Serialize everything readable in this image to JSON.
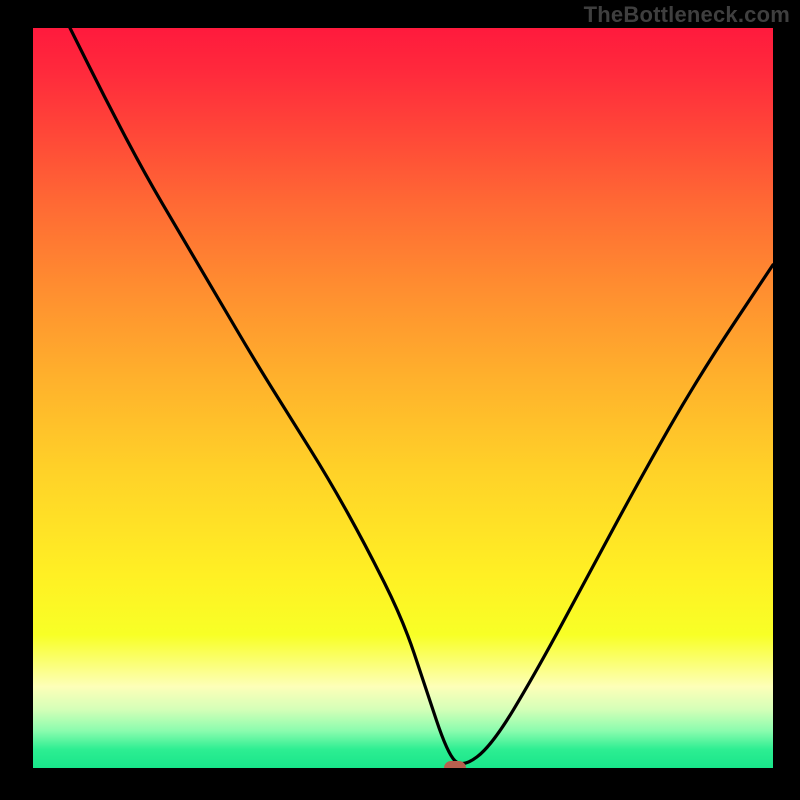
{
  "watermark": {
    "text": "TheBottleneck.com"
  },
  "colors": {
    "frame": "#000000",
    "curve": "#000000",
    "marker": "#b7604e",
    "watermark": "#3f3f3f"
  },
  "chart_data": {
    "type": "line",
    "title": "",
    "xlabel": "",
    "ylabel": "",
    "xlim": [
      0,
      100
    ],
    "ylim": [
      0,
      100
    ],
    "grid": false,
    "background_gradient": {
      "direction": "vertical",
      "stops": [
        {
          "pos": 0.0,
          "color": "#ff1a3d"
        },
        {
          "pos": 0.25,
          "color": "#ff6e34"
        },
        {
          "pos": 0.55,
          "color": "#ffd228"
        },
        {
          "pos": 0.8,
          "color": "#f6ff26"
        },
        {
          "pos": 0.9,
          "color": "#fdffb8"
        },
        {
          "pos": 0.95,
          "color": "#8afcae"
        },
        {
          "pos": 1.0,
          "color": "#18e58a"
        }
      ]
    },
    "series": [
      {
        "name": "bottleneck-curve",
        "x": [
          5,
          10,
          15,
          20,
          25,
          30,
          35,
          40,
          45,
          50,
          53,
          56,
          58,
          62,
          68,
          75,
          82,
          90,
          100
        ],
        "y": [
          100,
          90,
          80.5,
          72,
          63.5,
          55,
          47,
          39,
          30,
          20,
          11,
          2,
          0,
          3,
          13,
          26,
          39,
          53,
          68
        ]
      }
    ],
    "markers": [
      {
        "name": "optimal-point",
        "x": 57,
        "y": 0
      }
    ]
  }
}
